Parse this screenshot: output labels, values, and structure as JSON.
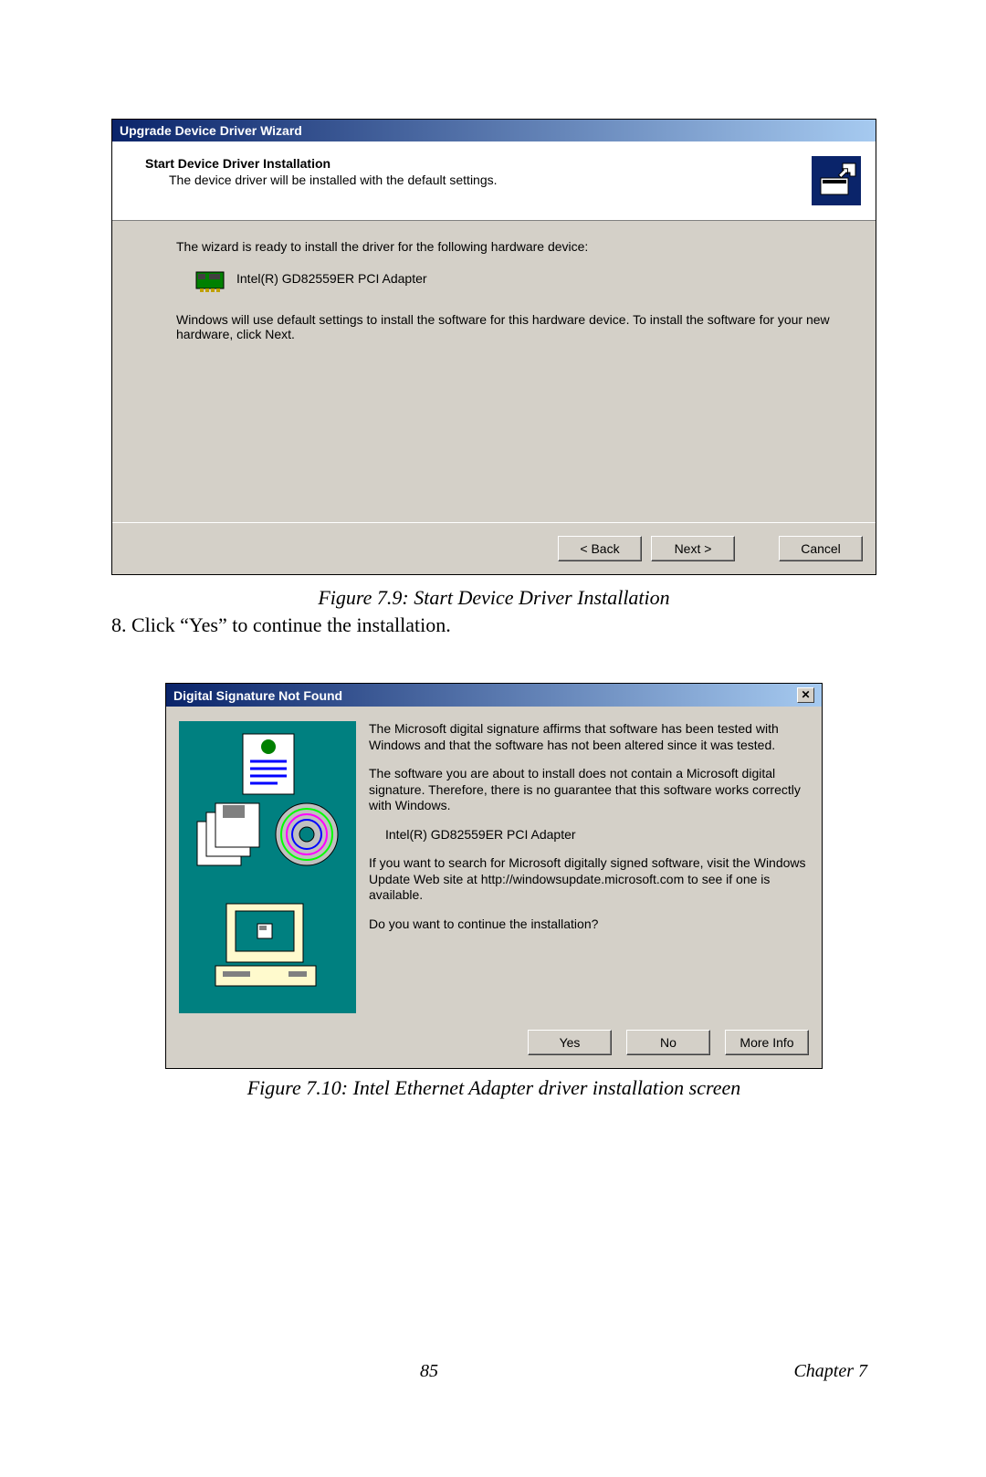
{
  "dialog1": {
    "title": "Upgrade Device Driver Wizard",
    "header_title": "Start Device Driver Installation",
    "header_sub": "The device driver will be installed with the default settings.",
    "line1": "The wizard is ready to install the driver for the following hardware device:",
    "device_name": "Intel(R) GD82559ER PCI Adapter",
    "line2": "Windows will use default settings to install the software for this hardware device. To install the software for your new hardware, click Next.",
    "back": "< Back",
    "next": "Next >",
    "cancel": "Cancel"
  },
  "caption1": "Figure 7.9: Start Device Driver Installation",
  "step8": "8. Click “Yes” to continue the installation.",
  "dialog2": {
    "title": "Digital Signature Not Found",
    "p1": "The Microsoft digital signature affirms that software has been tested with Windows and that the software has not been altered since it was tested.",
    "p2": "The software you are about to install does not contain a Microsoft digital signature. Therefore, there is no guarantee that this software works correctly with Windows.",
    "device_name": "Intel(R) GD82559ER PCI Adapter",
    "p3": "If you want to search for Microsoft digitally signed software, visit the Windows Update Web site at http://windowsupdate.microsoft.com to see if one is available.",
    "p4": "Do you want to continue the installation?",
    "yes": "Yes",
    "no": "No",
    "more": "More Info"
  },
  "caption2": "Figure 7.10: Intel Ethernet Adapter driver installation screen",
  "footer": {
    "page": "85",
    "chapter": "Chapter 7"
  }
}
